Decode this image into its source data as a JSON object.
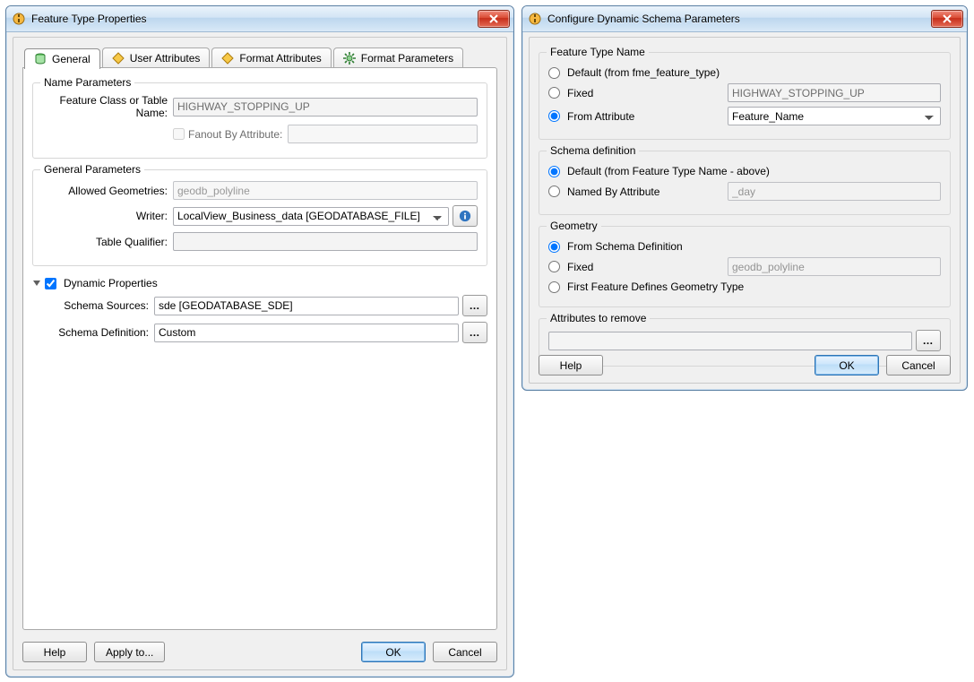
{
  "dialog1": {
    "title": "Feature Type Properties",
    "tabs": {
      "general": "General",
      "user_attributes": "User Attributes",
      "format_attributes": "Format Attributes",
      "format_parameters": "Format Parameters"
    },
    "name_params": {
      "legend": "Name Parameters",
      "feature_class_label": "Feature Class or Table Name:",
      "feature_class_value": "HIGHWAY_STOPPING_UP",
      "fanout_label": "Fanout By Attribute:",
      "fanout_value": ""
    },
    "general_params": {
      "legend": "General Parameters",
      "allowed_geom_label": "Allowed Geometries:",
      "allowed_geom_value": "geodb_polyline",
      "writer_label": "Writer:",
      "writer_value": "LocalView_Business_data [GEODATABASE_FILE]",
      "table_qualifier_label": "Table Qualifier:",
      "table_qualifier_value": ""
    },
    "dynamic": {
      "header": "Dynamic Properties",
      "schema_sources_label": "Schema Sources:",
      "schema_sources_value": "sde [GEODATABASE_SDE]",
      "schema_definition_label": "Schema Definition:",
      "schema_definition_value": "Custom"
    },
    "buttons": {
      "help": "Help",
      "apply_to": "Apply to...",
      "ok": "OK",
      "cancel": "Cancel"
    }
  },
  "dialog2": {
    "title": "Configure Dynamic Schema Parameters",
    "ftn": {
      "legend": "Feature Type Name",
      "default_label": "Default (from fme_feature_type)",
      "fixed_label": "Fixed",
      "fixed_value": "HIGHWAY_STOPPING_UP",
      "from_attr_label": "From Attribute",
      "from_attr_value": "Feature_Name",
      "selected": "from_attr"
    },
    "schema_def": {
      "legend": "Schema definition",
      "default_label": "Default (from Feature Type Name - above)",
      "named_label": "Named By Attribute",
      "named_value": "_day",
      "selected": "default"
    },
    "geometry": {
      "legend": "Geometry",
      "from_schema_label": "From Schema Definition",
      "fixed_label": "Fixed",
      "fixed_value": "geodb_polyline",
      "first_feature_label": "First Feature Defines Geometry Type",
      "selected": "from_schema"
    },
    "attrs_remove": {
      "legend": "Attributes to remove",
      "value": ""
    },
    "buttons": {
      "help": "Help",
      "ok": "OK",
      "cancel": "Cancel"
    }
  }
}
